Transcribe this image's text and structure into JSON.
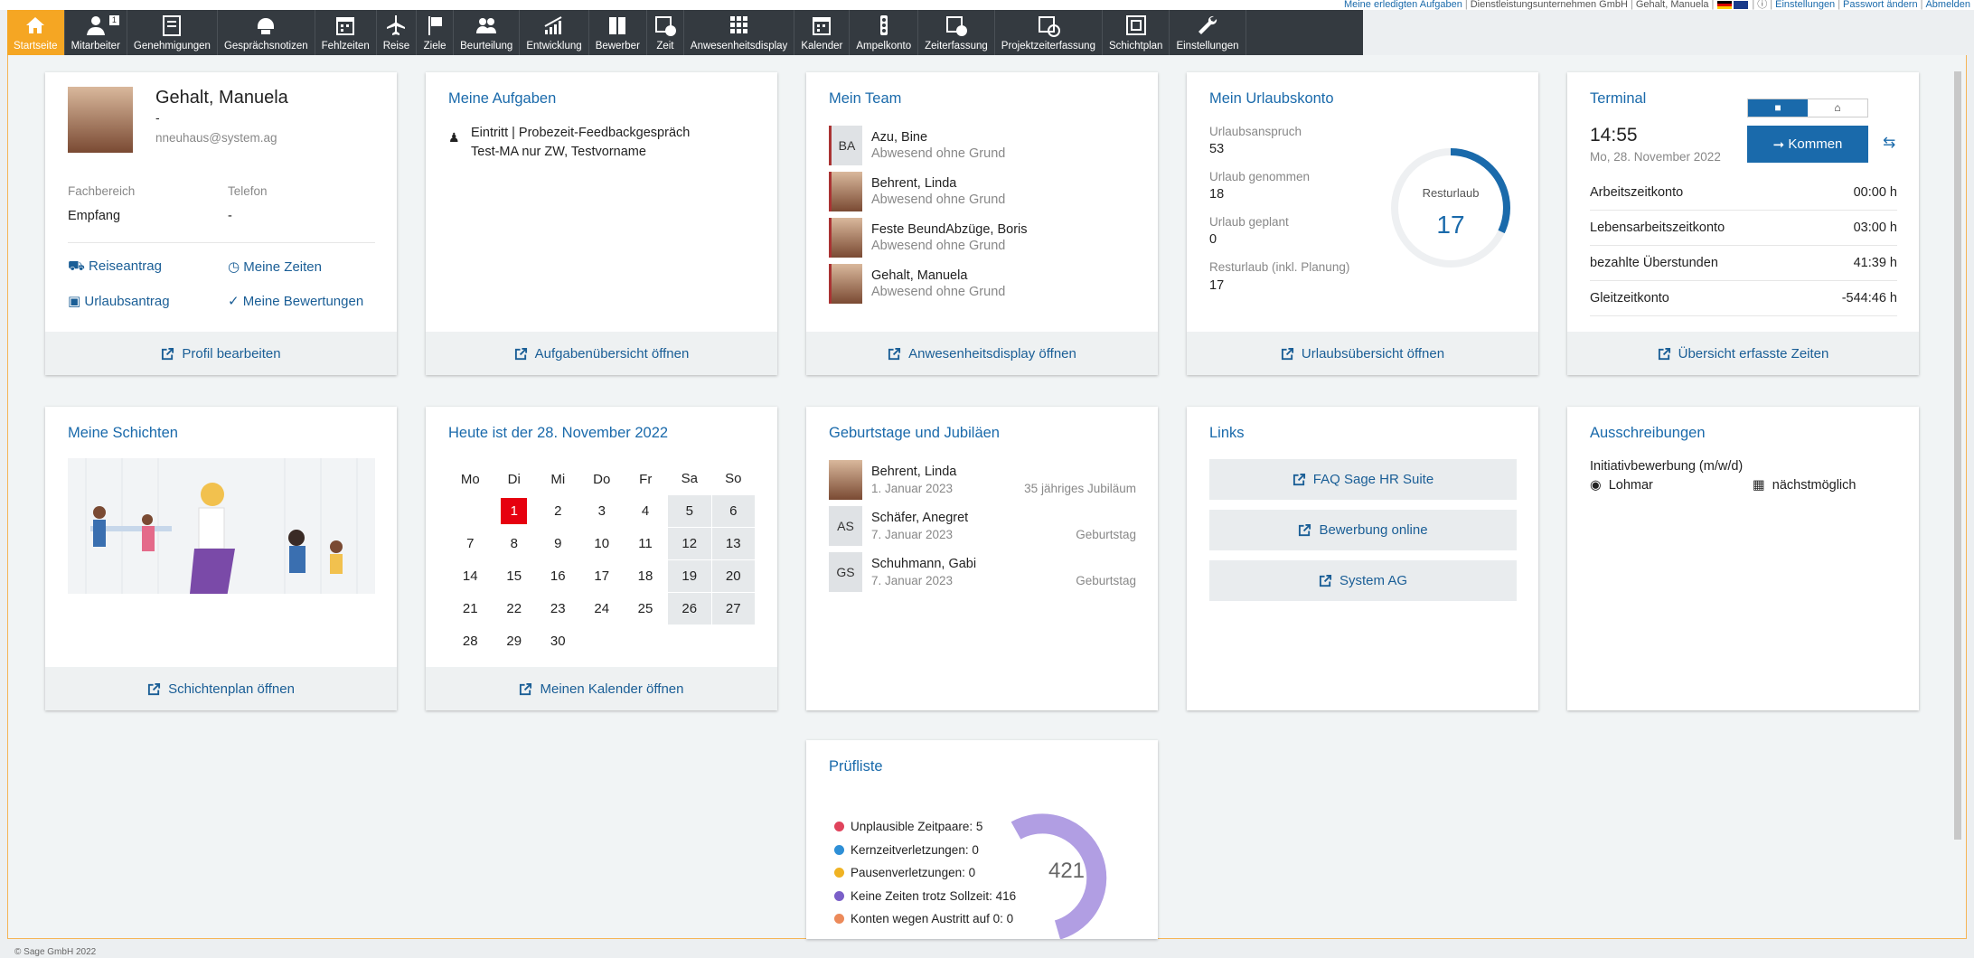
{
  "topbar": {
    "tasks": "Meine erledigten Aufgaben",
    "company": "Dienstleistungsunternehmen GmbH",
    "user": "Gehalt, Manuela",
    "settings": "Einstellungen",
    "password": "Passwort ändern",
    "logout": "Abmelden"
  },
  "nav": [
    {
      "label": "Startseite",
      "icon": "home-icon",
      "active": true
    },
    {
      "label": "Mitarbeiter",
      "icon": "employee-icon",
      "badge": "1"
    },
    {
      "label": "Genehmigungen",
      "icon": "approval-icon"
    },
    {
      "label": "Gesprächsnotizen",
      "icon": "notes-icon"
    },
    {
      "label": "Fehlzeiten",
      "icon": "calendar-icon"
    },
    {
      "label": "Reise",
      "icon": "airplane-icon"
    },
    {
      "label": "Ziele",
      "icon": "flag-icon"
    },
    {
      "label": "Beurteilung",
      "icon": "people-icon"
    },
    {
      "label": "Entwicklung",
      "icon": "chart-icon"
    },
    {
      "label": "Bewerber",
      "icon": "files-icon"
    },
    {
      "label": "Zeit",
      "icon": "clock-calendar-icon"
    },
    {
      "label": "Anwesenheitsdisplay",
      "icon": "grid-icon"
    },
    {
      "label": "Kalender",
      "icon": "calendar-icon"
    },
    {
      "label": "Ampelkonto",
      "icon": "traffic-light-icon"
    },
    {
      "label": "Zeiterfassung",
      "icon": "time-tracking-icon"
    },
    {
      "label": "Projektzeiterfassung",
      "icon": "project-time-icon"
    },
    {
      "label": "Schichtplan",
      "icon": "shift-plan-icon"
    },
    {
      "label": "Einstellungen",
      "icon": "wrench-icon"
    }
  ],
  "profile": {
    "name": "Gehalt, Manuela",
    "dash": "-",
    "email": "nneuhaus@system.ag",
    "dept_label": "Fachbereich",
    "dept": "Empfang",
    "phone_label": "Telefon",
    "phone": "-",
    "link1": "Reiseantrag",
    "link2": "Meine Zeiten",
    "link3": "Urlaubsantrag",
    "link4": "Meine Bewertungen",
    "footer": "Profil bearbeiten"
  },
  "tasks": {
    "title": "Meine Aufgaben",
    "item_title": "Eintritt | Probezeit-Feedbackgespräch",
    "item_sub": "Test-MA nur ZW, Testvorname",
    "footer": "Aufgabenübersicht öffnen"
  },
  "team": {
    "title": "Mein Team",
    "members": [
      {
        "initials": "BA",
        "name": "Azu, Bine",
        "status": "Abwesend ohne Grund"
      },
      {
        "initials": "",
        "name": "Behrent, Linda",
        "status": "Abwesend ohne Grund"
      },
      {
        "initials": "",
        "name": "Feste BeundAbzüge, Boris",
        "status": "Abwesend ohne Grund"
      },
      {
        "initials": "",
        "name": "Gehalt, Manuela",
        "status": "Abwesend ohne Grund"
      }
    ],
    "footer": "Anwesenheitsdisplay öffnen"
  },
  "vacation": {
    "title": "Mein Urlaubskonto",
    "l1": "Urlaubsanspruch",
    "v1": "53",
    "l2": "Urlaub genommen",
    "v2": "18",
    "l3": "Urlaub geplant",
    "v3": "0",
    "l4": "Resturlaub (inkl. Planung)",
    "v4": "17",
    "ring_label": "Resturlaub",
    "ring_value": "17",
    "ring_fraction": 0.32,
    "footer": "Urlaubsübersicht öffnen"
  },
  "terminal": {
    "title": "Terminal",
    "time": "14:55",
    "date": "Mo, 28. November 2022",
    "button": "Kommen",
    "rows": [
      {
        "label": "Arbeitszeitkonto",
        "value": "00:00 h"
      },
      {
        "label": "Lebensarbeitszeitkonto",
        "value": "03:00 h"
      },
      {
        "label": "bezahlte Überstunden",
        "value": "41:39 h"
      },
      {
        "label": "Gleitzeitkonto",
        "value": "-544:46 h"
      }
    ],
    "footer": "Übersicht erfasste Zeiten"
  },
  "shifts": {
    "title": "Meine Schichten",
    "footer": "Schichtenplan öffnen"
  },
  "calendar": {
    "title": "Heute ist der 28. November 2022",
    "days": [
      "Mo",
      "Di",
      "Mi",
      "Do",
      "Fr",
      "Sa",
      "So"
    ],
    "weeks": [
      [
        "",
        "1",
        "2",
        "3",
        "4",
        "5",
        "6"
      ],
      [
        "7",
        "8",
        "9",
        "10",
        "11",
        "12",
        "13"
      ],
      [
        "14",
        "15",
        "16",
        "17",
        "18",
        "19",
        "20"
      ],
      [
        "21",
        "22",
        "23",
        "24",
        "25",
        "26",
        "27"
      ],
      [
        "28",
        "29",
        "30",
        "",
        "",
        "",
        ""
      ]
    ],
    "today": "1",
    "footer": "Meinen Kalender öffnen"
  },
  "birthdays": {
    "title": "Geburtstage und Jubiläen",
    "items": [
      {
        "initials": "",
        "name": "Behrent, Linda",
        "date": "1. Januar 2023",
        "type": "35 jähriges Jubiläum"
      },
      {
        "initials": "AS",
        "name": "Schäfer, Anegret",
        "date": "7. Januar 2023",
        "type": "Geburtstag"
      },
      {
        "initials": "GS",
        "name": "Schuhmann, Gabi",
        "date": "7. Januar 2023",
        "type": "Geburtstag"
      }
    ]
  },
  "links": {
    "title": "Links",
    "items": [
      "FAQ Sage HR Suite",
      "Bewerbung online",
      "System AG"
    ]
  },
  "jobs": {
    "title": "Ausschreibungen",
    "job": "Initiativbewerbung (m/w/d)",
    "location": "Lohmar",
    "start": "nächstmöglich"
  },
  "checklist": {
    "title": "Prüfliste",
    "total": "421",
    "items": [
      {
        "label": "Unplausible Zeitpaare: 5",
        "color": "#e0435c"
      },
      {
        "label": "Kernzeitverletzungen: 0",
        "color": "#2e8fd6"
      },
      {
        "label": "Pausenverletzungen: 0",
        "color": "#f0b323"
      },
      {
        "label": "Keine Zeiten trotz Sollzeit: 416",
        "color": "#7a5fc8"
      },
      {
        "label": "Konten wegen Austritt auf 0: 0",
        "color": "#ec8a5a"
      }
    ]
  },
  "copyright": "© Sage GmbH 2022",
  "colors": {
    "accent": "#1a6aab",
    "nav": "#343a40",
    "active": "#f5a623"
  }
}
